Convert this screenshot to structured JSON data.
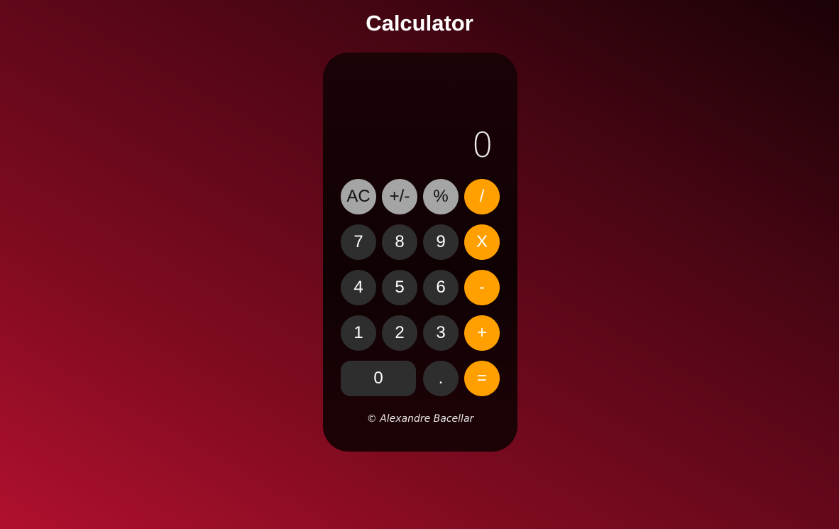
{
  "page": {
    "title": "Calculator"
  },
  "calculator": {
    "display_value": "0",
    "keys": {
      "ac": "AC",
      "sign": "+/-",
      "percent": "%",
      "divide": "/",
      "seven": "7",
      "eight": "8",
      "nine": "9",
      "multiply": "X",
      "four": "4",
      "five": "5",
      "six": "6",
      "subtract": "-",
      "one": "1",
      "two": "2",
      "three": "3",
      "add": "+",
      "zero": "0",
      "decimal": ".",
      "equals": "="
    },
    "footer": "© Alexandre Bacellar"
  },
  "colors": {
    "function_key": "#a5a5a5",
    "number_key": "#2e2e2e",
    "operator_key": "#ffa000",
    "background_start": "#b0102e",
    "background_end": "#1a0206"
  }
}
